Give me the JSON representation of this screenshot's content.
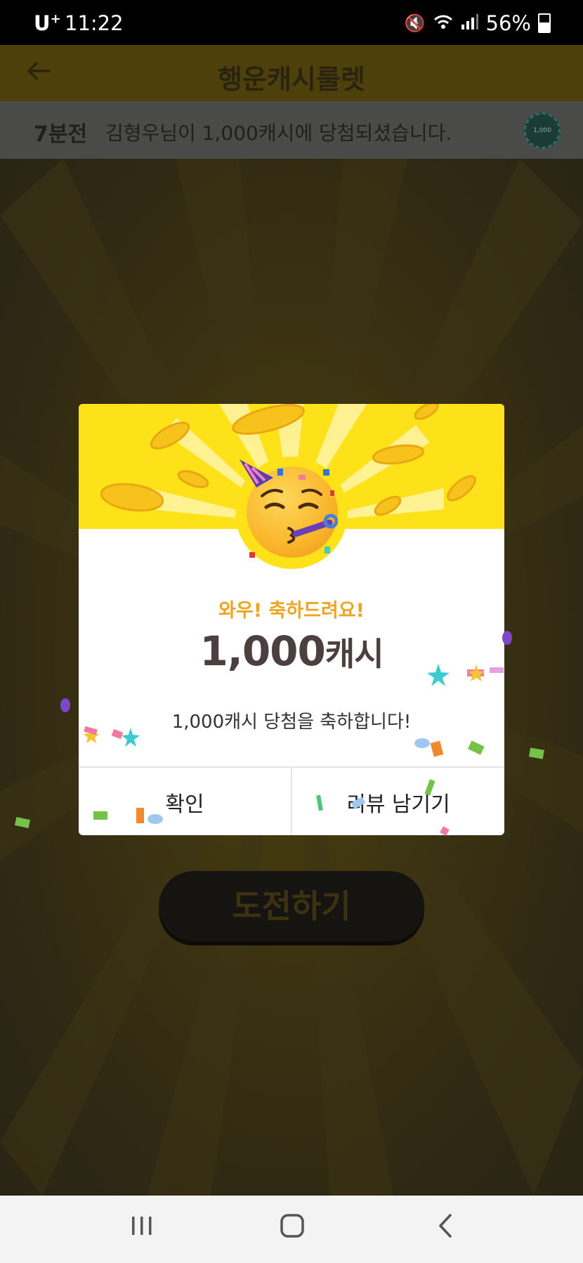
{
  "status_bar": {
    "carrier": "U",
    "carrier_plus": "+",
    "time": "11:22",
    "battery": "56%"
  },
  "app_bar": {
    "title": "행운캐시룰렛"
  },
  "ticker": {
    "when": "7분전",
    "message": "김형우님이 1,000캐시에 당첨되셨습니다.",
    "coin_label": "1,000"
  },
  "dialog": {
    "wow_text": "와우! 축하드려요!",
    "amount_number": "1,000",
    "amount_unit": "캐시",
    "description": "1,000캐시 당첨을 축하합니다!",
    "confirm_label": "확인",
    "review_label": "리뷰 남기기"
  },
  "background": {
    "challenge_label": "도전하기"
  },
  "colors": {
    "hero_yellow": "#fde21a",
    "wow_orange": "#f0a522",
    "amount_dark": "#4b3f3f"
  },
  "icons": {
    "back": "arrow-left-icon",
    "coin": "coin-icon",
    "emoji": "party-face-icon",
    "nav_recents": "recent-apps-icon",
    "nav_home": "home-icon",
    "nav_back": "back-chevron-icon"
  }
}
